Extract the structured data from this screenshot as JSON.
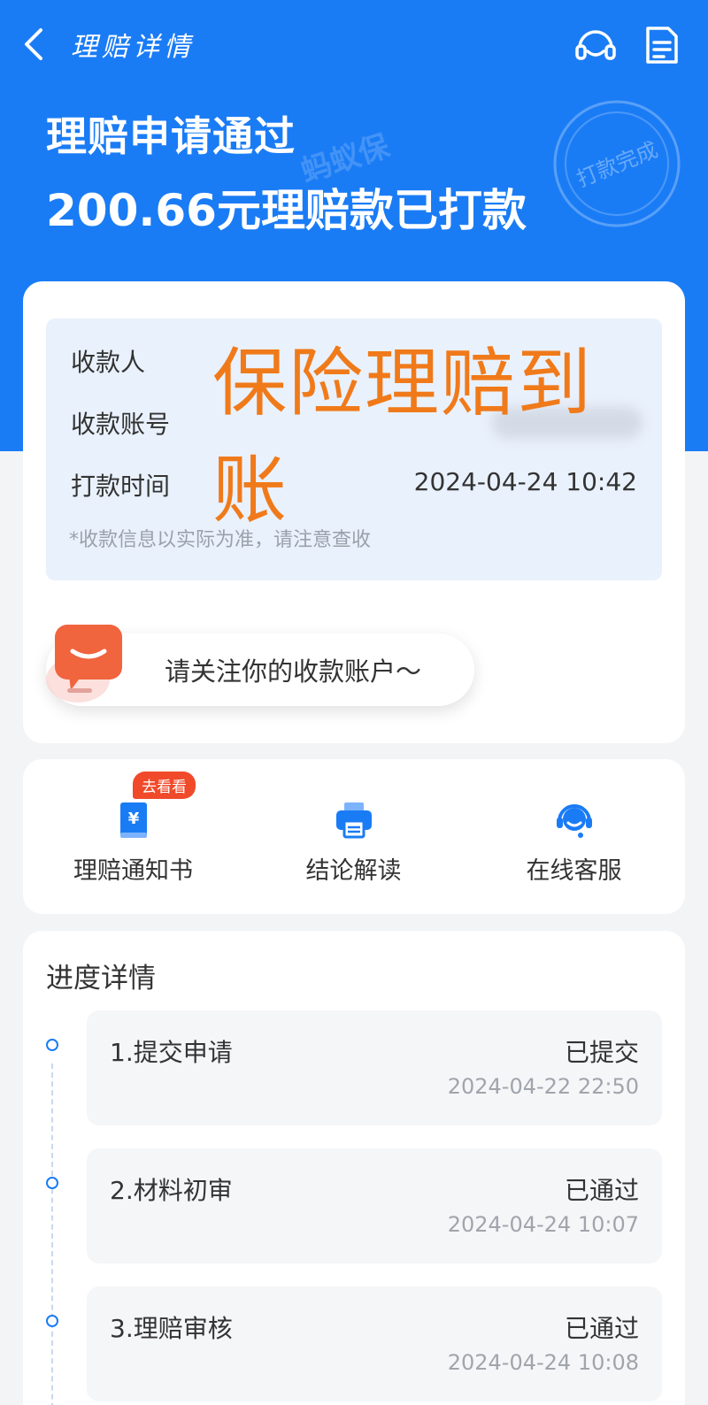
{
  "nav": {
    "title": "理赔详情",
    "back_icon": "chevron-left-icon",
    "service_icon": "headset-icon",
    "doc_icon": "document-icon"
  },
  "hero": {
    "title": "理赔申请通过",
    "subtitle": "200.66元理赔款已打款",
    "brand_watermark": "蚂蚁保",
    "stamp_text": "打款完成"
  },
  "payment": {
    "payee_label": "收款人",
    "account_label": "收款账号",
    "time_label": "打款时间",
    "time_value": "2024-04-24 10:42",
    "note": "*收款信息以实际为准，请注意查收",
    "overlay_caption": "保险理赔到账",
    "tip": "请关注你的收款账户～"
  },
  "actions": [
    {
      "label": "理赔通知书",
      "icon": "notice-book-icon",
      "badge": "去看看"
    },
    {
      "label": "结论解读",
      "icon": "printer-icon",
      "badge": ""
    },
    {
      "label": "在线客服",
      "icon": "customer-service-icon",
      "badge": ""
    }
  ],
  "progress": {
    "title": "进度详情",
    "steps": [
      {
        "name": "1.提交申请",
        "status": "已提交",
        "time": "2024-04-22 22:50"
      },
      {
        "name": "2.材料初审",
        "status": "已通过",
        "time": "2024-04-24 10:07"
      },
      {
        "name": "3.理赔审核",
        "status": "已通过",
        "time": "2024-04-24 10:08"
      }
    ]
  },
  "colors": {
    "primary": "#1a7cf5",
    "overlay": "#f07a1a",
    "badge": "#f04a2a"
  }
}
